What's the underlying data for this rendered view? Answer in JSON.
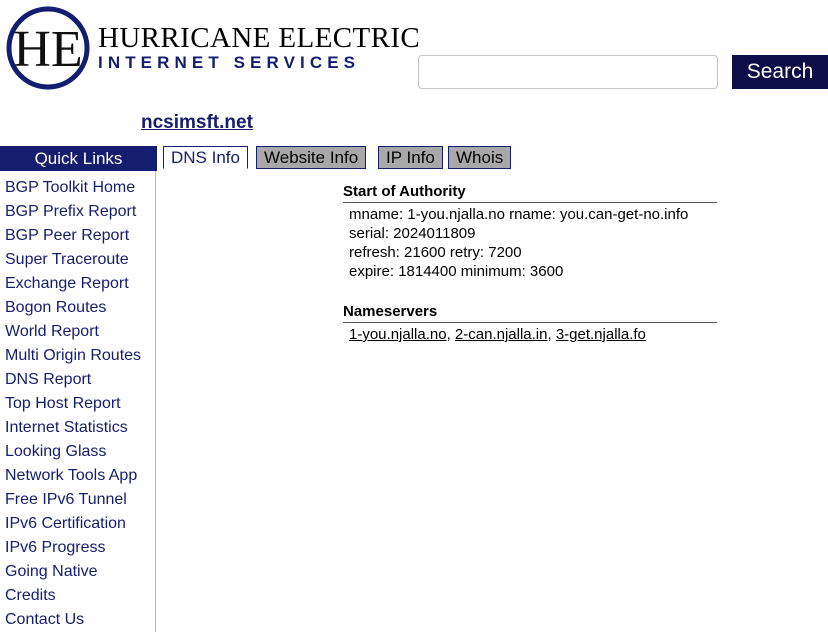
{
  "brand": {
    "monogram": "HE",
    "primary": "HURRICANE ELECTRIC",
    "secondary": "INTERNET SERVICES",
    "navy": "#151d6e"
  },
  "search": {
    "value": "",
    "placeholder": "",
    "button_label": "Search"
  },
  "page_title": "ncsimsft.net",
  "tabs": [
    {
      "label": "DNS Info",
      "active": true
    },
    {
      "label": "Website Info",
      "active": false
    },
    {
      "label": "IP Info",
      "active": false
    },
    {
      "label": "Whois",
      "active": false
    }
  ],
  "sidebar": {
    "header": "Quick Links",
    "items": [
      {
        "label": "BGP Toolkit Home"
      },
      {
        "label": "BGP Prefix Report"
      },
      {
        "label": "BGP Peer Report"
      },
      {
        "label": "Super Traceroute"
      },
      {
        "label": "Exchange Report"
      },
      {
        "label": "Bogon Routes"
      },
      {
        "label": "World Report"
      },
      {
        "label": "Multi Origin Routes"
      },
      {
        "label": "DNS Report"
      },
      {
        "label": "Top Host Report"
      },
      {
        "label": "Internet Statistics"
      },
      {
        "label": "Looking Glass"
      },
      {
        "label": "Network Tools App"
      },
      {
        "label": "Free IPv6 Tunnel"
      },
      {
        "label": "IPv6 Certification"
      },
      {
        "label": "IPv6 Progress"
      },
      {
        "label": "Going Native"
      },
      {
        "label": "Credits"
      },
      {
        "label": "Contact Us"
      }
    ]
  },
  "dns": {
    "soa": {
      "heading": "Start of Authority",
      "lines": [
        "mname: 1-you.njalla.no rname: you.can-get-no.info",
        "serial: 2024011809",
        "refresh: 21600 retry: 7200",
        "expire: 1814400 minimum: 3600"
      ]
    },
    "nameservers": {
      "heading": "Nameservers",
      "items": [
        "1-you.njalla.no",
        "2-can.njalla.in",
        "3-get.njalla.fo"
      ],
      "separator": ", "
    }
  }
}
